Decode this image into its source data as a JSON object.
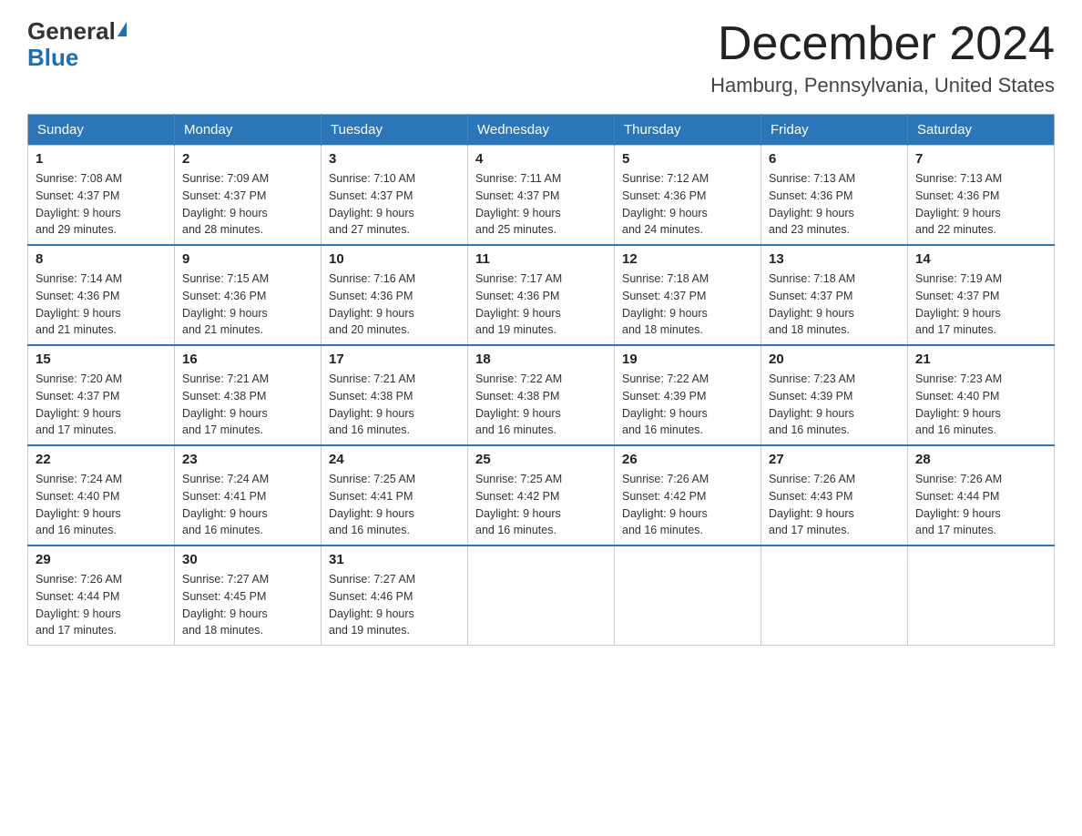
{
  "logo": {
    "general": "General",
    "triangle": "▲",
    "blue": "Blue"
  },
  "title": "December 2024",
  "subtitle": "Hamburg, Pennsylvania, United States",
  "days_of_week": [
    "Sunday",
    "Monday",
    "Tuesday",
    "Wednesday",
    "Thursday",
    "Friday",
    "Saturday"
  ],
  "weeks": [
    [
      {
        "day": 1,
        "sunrise": "7:08 AM",
        "sunset": "4:37 PM",
        "daylight": "9 hours and 29 minutes."
      },
      {
        "day": 2,
        "sunrise": "7:09 AM",
        "sunset": "4:37 PM",
        "daylight": "9 hours and 28 minutes."
      },
      {
        "day": 3,
        "sunrise": "7:10 AM",
        "sunset": "4:37 PM",
        "daylight": "9 hours and 27 minutes."
      },
      {
        "day": 4,
        "sunrise": "7:11 AM",
        "sunset": "4:37 PM",
        "daylight": "9 hours and 25 minutes."
      },
      {
        "day": 5,
        "sunrise": "7:12 AM",
        "sunset": "4:36 PM",
        "daylight": "9 hours and 24 minutes."
      },
      {
        "day": 6,
        "sunrise": "7:13 AM",
        "sunset": "4:36 PM",
        "daylight": "9 hours and 23 minutes."
      },
      {
        "day": 7,
        "sunrise": "7:13 AM",
        "sunset": "4:36 PM",
        "daylight": "9 hours and 22 minutes."
      }
    ],
    [
      {
        "day": 8,
        "sunrise": "7:14 AM",
        "sunset": "4:36 PM",
        "daylight": "9 hours and 21 minutes."
      },
      {
        "day": 9,
        "sunrise": "7:15 AM",
        "sunset": "4:36 PM",
        "daylight": "9 hours and 21 minutes."
      },
      {
        "day": 10,
        "sunrise": "7:16 AM",
        "sunset": "4:36 PM",
        "daylight": "9 hours and 20 minutes."
      },
      {
        "day": 11,
        "sunrise": "7:17 AM",
        "sunset": "4:36 PM",
        "daylight": "9 hours and 19 minutes."
      },
      {
        "day": 12,
        "sunrise": "7:18 AM",
        "sunset": "4:37 PM",
        "daylight": "9 hours and 18 minutes."
      },
      {
        "day": 13,
        "sunrise": "7:18 AM",
        "sunset": "4:37 PM",
        "daylight": "9 hours and 18 minutes."
      },
      {
        "day": 14,
        "sunrise": "7:19 AM",
        "sunset": "4:37 PM",
        "daylight": "9 hours and 17 minutes."
      }
    ],
    [
      {
        "day": 15,
        "sunrise": "7:20 AM",
        "sunset": "4:37 PM",
        "daylight": "9 hours and 17 minutes."
      },
      {
        "day": 16,
        "sunrise": "7:21 AM",
        "sunset": "4:38 PM",
        "daylight": "9 hours and 17 minutes."
      },
      {
        "day": 17,
        "sunrise": "7:21 AM",
        "sunset": "4:38 PM",
        "daylight": "9 hours and 16 minutes."
      },
      {
        "day": 18,
        "sunrise": "7:22 AM",
        "sunset": "4:38 PM",
        "daylight": "9 hours and 16 minutes."
      },
      {
        "day": 19,
        "sunrise": "7:22 AM",
        "sunset": "4:39 PM",
        "daylight": "9 hours and 16 minutes."
      },
      {
        "day": 20,
        "sunrise": "7:23 AM",
        "sunset": "4:39 PM",
        "daylight": "9 hours and 16 minutes."
      },
      {
        "day": 21,
        "sunrise": "7:23 AM",
        "sunset": "4:40 PM",
        "daylight": "9 hours and 16 minutes."
      }
    ],
    [
      {
        "day": 22,
        "sunrise": "7:24 AM",
        "sunset": "4:40 PM",
        "daylight": "9 hours and 16 minutes."
      },
      {
        "day": 23,
        "sunrise": "7:24 AM",
        "sunset": "4:41 PM",
        "daylight": "9 hours and 16 minutes."
      },
      {
        "day": 24,
        "sunrise": "7:25 AM",
        "sunset": "4:41 PM",
        "daylight": "9 hours and 16 minutes."
      },
      {
        "day": 25,
        "sunrise": "7:25 AM",
        "sunset": "4:42 PM",
        "daylight": "9 hours and 16 minutes."
      },
      {
        "day": 26,
        "sunrise": "7:26 AM",
        "sunset": "4:42 PM",
        "daylight": "9 hours and 16 minutes."
      },
      {
        "day": 27,
        "sunrise": "7:26 AM",
        "sunset": "4:43 PM",
        "daylight": "9 hours and 17 minutes."
      },
      {
        "day": 28,
        "sunrise": "7:26 AM",
        "sunset": "4:44 PM",
        "daylight": "9 hours and 17 minutes."
      }
    ],
    [
      {
        "day": 29,
        "sunrise": "7:26 AM",
        "sunset": "4:44 PM",
        "daylight": "9 hours and 17 minutes."
      },
      {
        "day": 30,
        "sunrise": "7:27 AM",
        "sunset": "4:45 PM",
        "daylight": "9 hours and 18 minutes."
      },
      {
        "day": 31,
        "sunrise": "7:27 AM",
        "sunset": "4:46 PM",
        "daylight": "9 hours and 19 minutes."
      },
      null,
      null,
      null,
      null
    ]
  ]
}
